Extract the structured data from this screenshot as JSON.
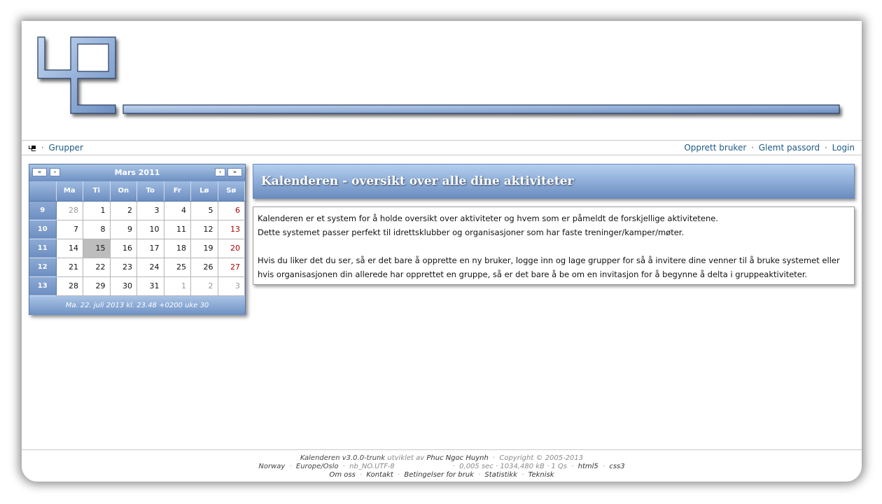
{
  "nav": {
    "groups_label": "Grupper",
    "create_user_label": "Opprett bruker",
    "forgot_password_label": "Glemt passord",
    "login_label": "Login"
  },
  "calendar": {
    "month_title": "Mars 2011",
    "prev_year_label": "«",
    "prev_month_label": "‹",
    "next_month_label": "›",
    "next_year_label": "»",
    "weekdays": [
      "Ma",
      "Ti",
      "On",
      "To",
      "Fr",
      "Lø",
      "Sø"
    ],
    "weeks": [
      {
        "wk": "9",
        "days": [
          "28",
          "1",
          "2",
          "3",
          "4",
          "5",
          "6"
        ]
      },
      {
        "wk": "10",
        "days": [
          "7",
          "8",
          "9",
          "10",
          "11",
          "12",
          "13"
        ]
      },
      {
        "wk": "11",
        "days": [
          "14",
          "15",
          "16",
          "17",
          "18",
          "19",
          "20"
        ]
      },
      {
        "wk": "12",
        "days": [
          "21",
          "22",
          "23",
          "24",
          "25",
          "26",
          "27"
        ]
      },
      {
        "wk": "13",
        "days": [
          "28",
          "29",
          "30",
          "31",
          "1",
          "2",
          "3"
        ]
      }
    ],
    "footer_text": "Ma. 22. juli 2013 kl. 23.48 +0200 uke 30"
  },
  "main": {
    "heading": "Kalenderen - oversikt over alle dine aktiviteter",
    "p1": "Kalenderen er et system for å holde oversikt over aktiviteter og hvem som er påmeldt de forskjellige aktivitetene.",
    "p2": "Dette systemet passer perfekt til idrettsklubber og organisasjoner som har faste treninger/kamper/møter.",
    "p3": "Hvis du liker det du ser, så er det bare å opprette en ny bruker, logge inn og lage grupper for så å invitere dine venner til å bruke systemet eller hvis organisasjonen din allerede har opprettet en gruppe, så er det bare å be om en invitasjon for å begynne å delta i gruppeaktiviteter."
  },
  "footer": {
    "app_name": "Kalenderen v3.0.0-trunk",
    "developed_by": "utviklet av",
    "author": "Phuc Ngoc Huynh",
    "copyright": "Copyright © 2005-2013",
    "country": "Norway",
    "timezone": "Europe/Oslo",
    "locale": "nb_NO.UTF-8",
    "stats": "0,005 sec · 1034,480 kB · 1 Qs",
    "html5": "html5",
    "css3": "css3",
    "links": [
      "Om oss",
      "Kontakt",
      "Betingelser for bruk",
      "Statistikk",
      "Teknisk"
    ]
  },
  "colors": {
    "accent": "#6a8cc0",
    "accent_light": "#b4cff0",
    "link": "#1c5a86",
    "sunday": "#b00000"
  }
}
